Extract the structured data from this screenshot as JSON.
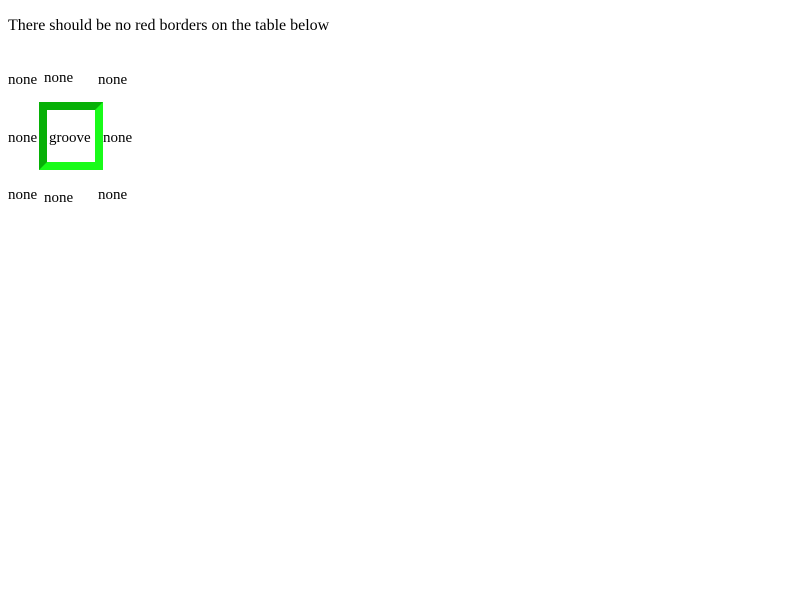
{
  "heading": "There should be no red borders on the table below",
  "table": {
    "row1": [
      "none",
      "none",
      "none"
    ],
    "row2": [
      "none",
      "groove",
      "none"
    ],
    "row3": [
      "none",
      "none",
      "none"
    ]
  },
  "colors": {
    "groove_dark": "#07b007",
    "groove_light": "#19fb19"
  }
}
